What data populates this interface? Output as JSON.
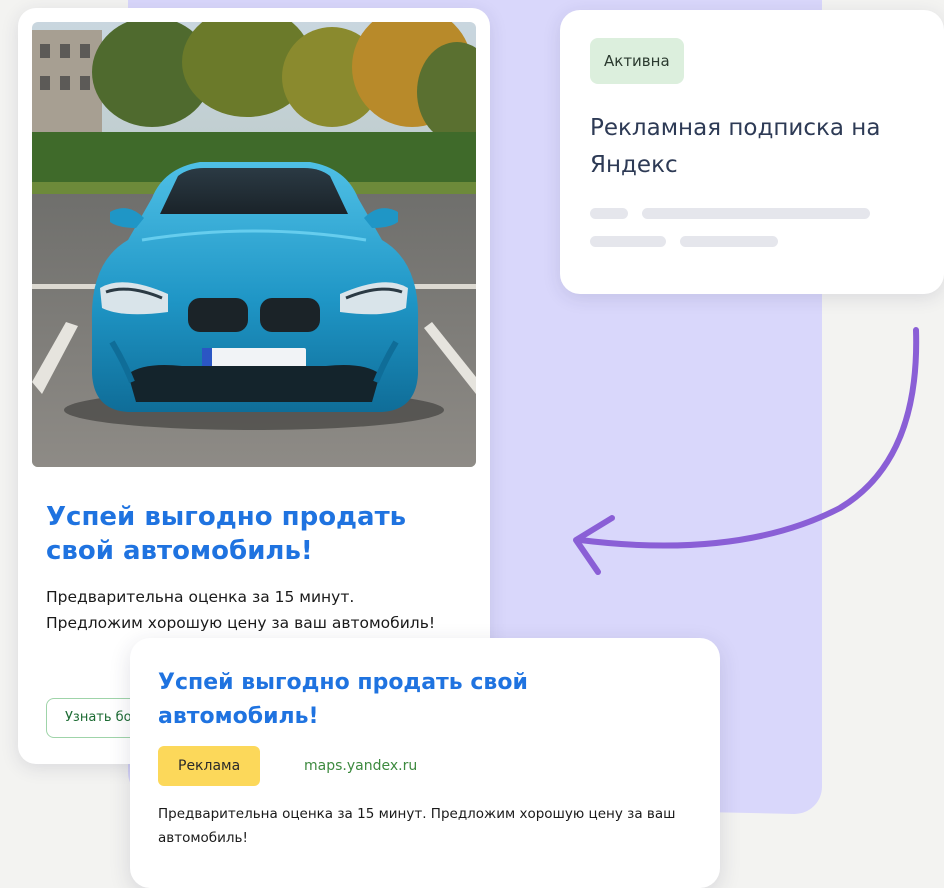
{
  "ad_card": {
    "photo_icon": "car-photo",
    "title": "Успей выгодно продать свой автомобиль!",
    "description": "Предварительна оценка за 15 минут. Предложим хорошую цену за ваш автомобиль!",
    "button_label": "Узнать больше"
  },
  "subscription_card": {
    "status": "Активна",
    "title": "Рекламная подписка на Яндекс"
  },
  "overlay_card": {
    "title": "Успей выгодно продать свой автомобиль!",
    "ad_label": "Реклама",
    "domain": "maps.yandex.ru",
    "description": "Предварительна оценка за 15 минут.  Предложим хорошую цену за ваш автомобиль!"
  },
  "colors": {
    "accent_blue": "#1f73e0",
    "panel_lavender": "#d9d7fb",
    "arrow_purple": "#8a5fd6",
    "badge_green": "#dcefdd",
    "ad_label_yellow": "#fcd85a",
    "domain_green": "#3d8a3f"
  }
}
